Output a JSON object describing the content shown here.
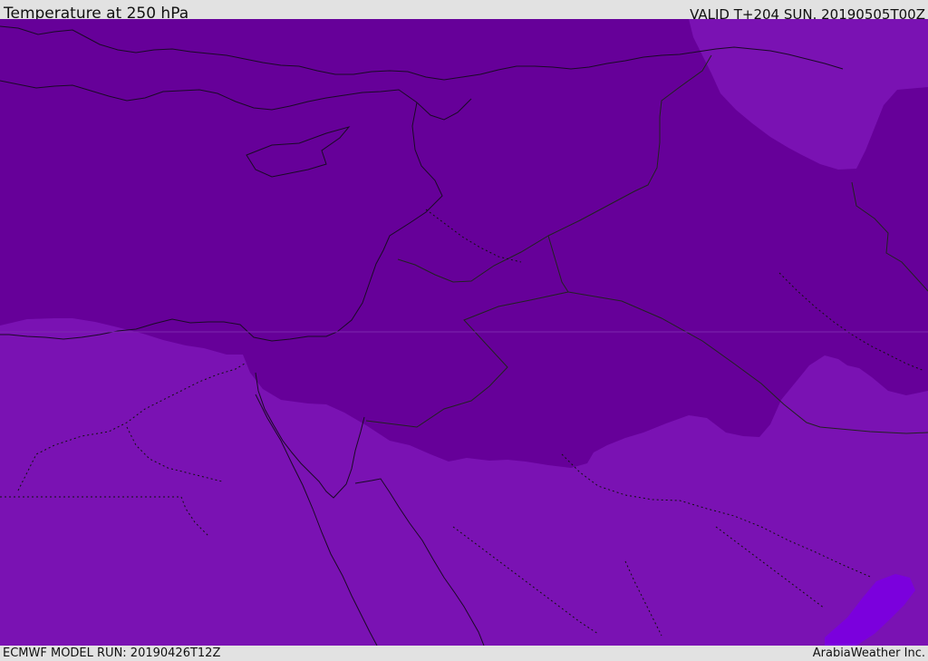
{
  "header": {
    "title": "Temperature at 250 hPa",
    "valid_time": "VALID T+204 SUN. 20190505T00Z"
  },
  "footer": {
    "model_run": "ECMWF MODEL RUN: 20190426T12Z",
    "credit": "ArabiaWeather Inc."
  },
  "map": {
    "colors": {
      "dark_band": "#660099",
      "mid_band": "#7a12b3",
      "light_patch": "#7b00dd",
      "coast_line": "#1a0a26",
      "border_line": "#222"
    }
  }
}
